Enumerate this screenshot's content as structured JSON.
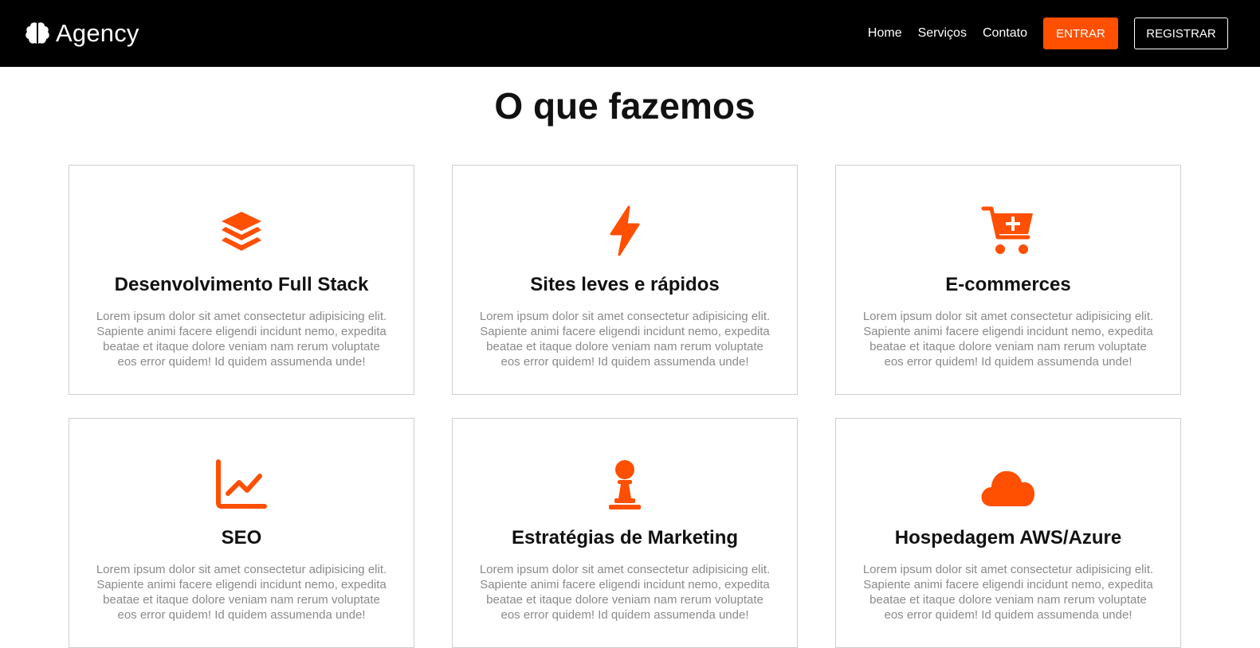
{
  "brand": {
    "name": "Agency",
    "icon": "brain-icon"
  },
  "nav": {
    "links": [
      "Home",
      "Serviços",
      "Contato"
    ],
    "enter_label": "ENTRAR",
    "register_label": "REGISTRAR"
  },
  "section": {
    "title": "O que fazemos"
  },
  "colors": {
    "accent": "#ff4f00",
    "navbar": "#000000",
    "border": "#cfcfcf",
    "text_muted": "#8a8a8a"
  },
  "cards": [
    {
      "icon": "layers-icon",
      "title": "Desenvolvimento Full Stack",
      "text": "Lorem ipsum dolor sit amet consectetur adipisicing elit. Sapiente animi facere eligendi incidunt nemo, expedita beatae et itaque dolore veniam nam rerum voluptate eos error quidem! Id quidem assumenda unde!"
    },
    {
      "icon": "bolt-icon",
      "title": "Sites leves e rápidos",
      "text": "Lorem ipsum dolor sit amet consectetur adipisicing elit. Sapiente animi facere eligendi incidunt nemo, expedita beatae et itaque dolore veniam nam rerum voluptate eos error quidem! Id quidem assumenda unde!"
    },
    {
      "icon": "cart-plus-icon",
      "title": "E-commerces",
      "text": "Lorem ipsum dolor sit amet consectetur adipisicing elit. Sapiente animi facere eligendi incidunt nemo, expedita beatae et itaque dolore veniam nam rerum voluptate eos error quidem! Id quidem assumenda unde!"
    },
    {
      "icon": "chart-line-icon",
      "title": "SEO",
      "text": "Lorem ipsum dolor sit amet consectetur adipisicing elit. Sapiente animi facere eligendi incidunt nemo, expedita beatae et itaque dolore veniam nam rerum voluptate eos error quidem! Id quidem assumenda unde!"
    },
    {
      "icon": "chess-pawn-icon",
      "title": "Estratégias de Marketing",
      "text": "Lorem ipsum dolor sit amet consectetur adipisicing elit. Sapiente animi facere eligendi incidunt nemo, expedita beatae et itaque dolore veniam nam rerum voluptate eos error quidem! Id quidem assumenda unde!"
    },
    {
      "icon": "cloud-icon",
      "title": "Hospedagem AWS/Azure",
      "text": "Lorem ipsum dolor sit amet consectetur adipisicing elit. Sapiente animi facere eligendi incidunt nemo, expedita beatae et itaque dolore veniam nam rerum voluptate eos error quidem! Id quidem assumenda unde!"
    }
  ]
}
